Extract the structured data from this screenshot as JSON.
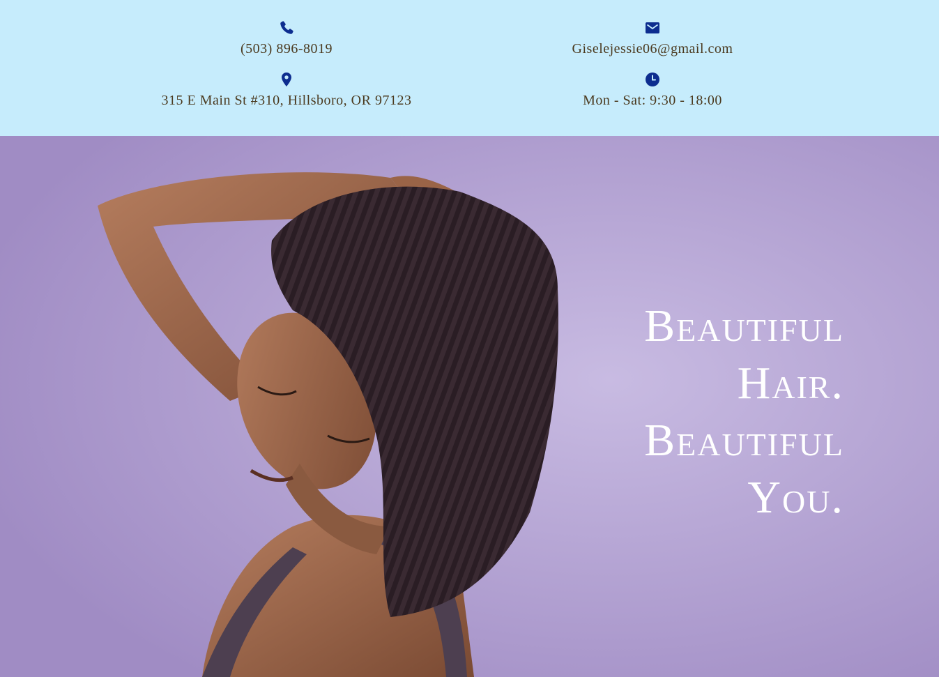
{
  "contact": {
    "phone": "(503) 896-8019",
    "email": "Giselejessie06@gmail.com",
    "address": "315 E Main St #310, Hillsboro, OR 97123",
    "hours": "Mon - Sat: 9:30 - 18:00"
  },
  "icons": {
    "phone": "phone-icon",
    "email": "envelope-icon",
    "address": "map-pin-icon",
    "hours": "clock-icon"
  },
  "colors": {
    "topbar_bg": "#c6ecfc",
    "icon_blue": "#0d2d8f",
    "text_brown": "#4b3a1f",
    "hero_lavender": "#bcaed9",
    "headline_white": "#ffffff"
  },
  "hero": {
    "headline": [
      "Beautiful",
      "Hair.",
      "Beautiful",
      "You."
    ]
  }
}
